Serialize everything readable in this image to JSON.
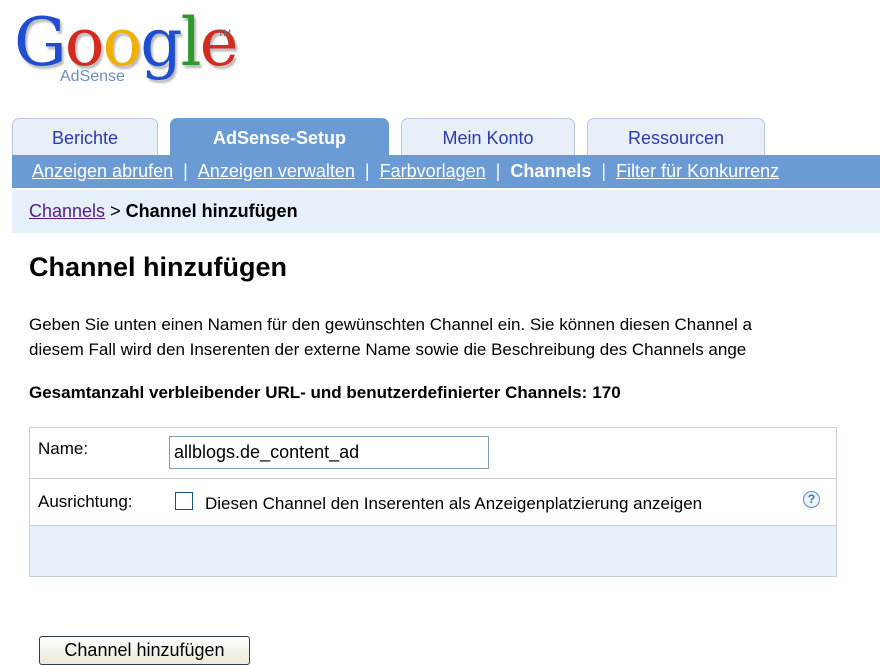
{
  "logo": {
    "letters": [
      {
        "ch": "G",
        "color": "#1f4ed1"
      },
      {
        "ch": "o",
        "color": "#d32b22"
      },
      {
        "ch": "o",
        "color": "#f2b000"
      },
      {
        "ch": "g",
        "color": "#1f4ed1"
      },
      {
        "ch": "l",
        "color": "#2e9a2e"
      },
      {
        "ch": "e",
        "color": "#d32b22"
      }
    ],
    "tm": "TM",
    "sub": "AdSense"
  },
  "tabs": [
    {
      "label": "Berichte",
      "active": false
    },
    {
      "label": "AdSense-Setup",
      "active": true
    },
    {
      "label": "Mein Konto",
      "active": false
    },
    {
      "label": "Ressourcen",
      "active": false
    }
  ],
  "subnav": [
    {
      "label": "Anzeigen abrufen",
      "current": false
    },
    {
      "label": "Anzeigen verwalten",
      "current": false
    },
    {
      "label": "Farbvorlagen",
      "current": false
    },
    {
      "label": "Channels",
      "current": true
    },
    {
      "label": "Filter für Konkurrenz",
      "current": false
    }
  ],
  "subnav_separator": "|",
  "breadcrumb": {
    "link": "Channels",
    "arrow": ">",
    "current": "Channel hinzufügen"
  },
  "page_title": "Channel hinzufügen",
  "description": {
    "line1": "Geben Sie unten einen Namen für den gewünschten Channel ein. Sie können diesen Channel a",
    "line2": "diesem Fall wird den Inserenten der externe Name sowie die Beschreibung des Channels ange"
  },
  "count": {
    "label": "Gesamtanzahl verbleibender URL- und benutzerdefinierter Channels:",
    "value": "170"
  },
  "form": {
    "name_label": "Name:",
    "name_value": "allblogs.de_content_ad",
    "targeting_label": "Ausrichtung:",
    "checkbox_checked": false,
    "checkbox_label": "Diesen Channel den Inserenten als Anzeigenplatzierung anzeigen",
    "help_glyph": "?",
    "submit_label": "Channel hinzufügen"
  },
  "colors": {
    "accent": "#6b9bd5",
    "light_band": "#e6f0fb",
    "tab_text": "#2a3bb0"
  }
}
